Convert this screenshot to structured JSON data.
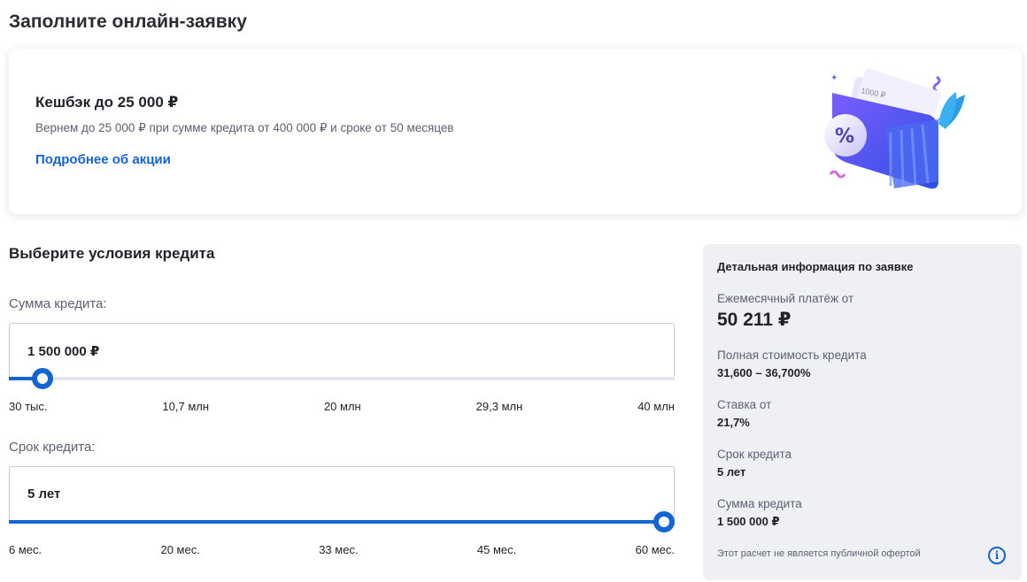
{
  "page": {
    "title": "Заполните онлайн-заявку"
  },
  "promo": {
    "title": "Кешбэк до 25 000 ₽",
    "description": "Вернем до 25 000 ₽ при сумме кредита от 400 000 ₽ и сроке от 50 месяцев",
    "link": "Подробнее об акции",
    "art_icon": "wallet-percent-illustration",
    "art_banknote": "1000 ₽"
  },
  "conditions": {
    "title": "Выберите условия кредита",
    "amount": {
      "label": "Сумма кредита:",
      "value": "1 500 000 ₽",
      "slider_fraction": 0.05,
      "ticks": [
        "30 тыс.",
        "10,7 млн",
        "20 млн",
        "29,3 млн",
        "40 млн"
      ]
    },
    "term": {
      "label": "Срок кредита:",
      "value": "5 лет",
      "slider_fraction": 1.0,
      "ticks": [
        "6 мес.",
        "20 мес.",
        "33 мес.",
        "45 мес.",
        "60 мес."
      ]
    }
  },
  "info": {
    "heading": "Детальная информация по заявке",
    "monthly_label": "Ежемесячный платёж от",
    "monthly_value": "50 211 ₽",
    "full_cost_label": "Полная стоимость кредита",
    "full_cost_value": "31,600 – 36,700%",
    "rate_label": "Ставка от",
    "rate_value": "21,7%",
    "term_label": "Срок кредита",
    "term_value": "5 лет",
    "amount_label": "Сумма кредита",
    "amount_value": "1 500 000 ₽",
    "note": "Этот расчет не является публичной офертой",
    "note_icon": "info-icon"
  },
  "colors": {
    "accent": "#1464d2",
    "panel": "#eef0f4",
    "text_muted": "#5b6270"
  }
}
